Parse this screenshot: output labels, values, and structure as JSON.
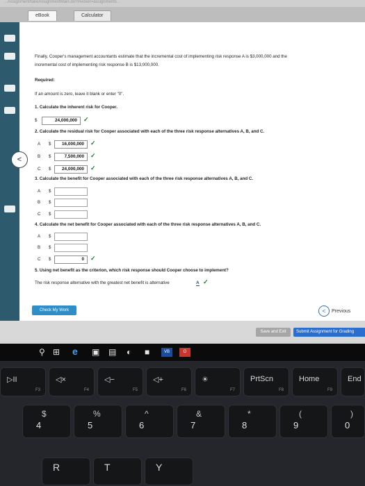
{
  "browser": {
    "url_fragment": "...Assignment/takeAssignmentMain.do?invoker=assignments...",
    "tabs": [
      "eBook",
      "Calculator"
    ]
  },
  "problem": {
    "intro_line1": "Finally, Cooper's management accountants estimate that the incremental cost of implementing risk response A is $3,000,000 and the",
    "intro_line2": "incremental cost of implementing risk response B is $13,000,000.",
    "required_label": "Required:",
    "zero_instruction": "If an amount is zero, leave it blank or enter \"0\".",
    "q1": "1. Calculate the inherent risk for Cooper.",
    "q1_answer": "24,000,000",
    "q2": "2. Calculate the residual risk for Cooper associated with each of the three risk response alternatives A, B, and C.",
    "q2_answers": [
      {
        "label": "A",
        "value": "16,000,000"
      },
      {
        "label": "B",
        "value": "7,500,000"
      },
      {
        "label": "C",
        "value": "24,000,000"
      }
    ],
    "q3": "3. Calculate the benefit for Cooper associated with each of the three risk response alternatives A, B, and C.",
    "q3_answers": [
      {
        "label": "A",
        "value": ""
      },
      {
        "label": "B",
        "value": ""
      },
      {
        "label": "C",
        "value": ""
      }
    ],
    "q4": "4. Calculate the net benefit for Cooper associated with each of the three risk response alternatives A, B, and C.",
    "q4_answers": [
      {
        "label": "A",
        "value": ""
      },
      {
        "label": "B",
        "value": ""
      },
      {
        "label": "C",
        "value": "0"
      }
    ],
    "q5": "5. Using net benefit as the criterion, which risk response should Cooper choose to implement?",
    "q5_sentence": "The risk response alternative with the greatest net benefit is alternative",
    "q5_answer": "A",
    "dollar": "$"
  },
  "buttons": {
    "check_my_work": "Check My Work",
    "previous": "Previous",
    "save_exit": "Save and Exit",
    "submit": "Submit Assignment for Grading"
  },
  "keyboard": {
    "fn_row": [
      {
        "main": "▷II",
        "sub": "F3"
      },
      {
        "main": "◁×",
        "sub": "F4"
      },
      {
        "main": "◁−",
        "sub": "F5"
      },
      {
        "main": "◁+",
        "sub": "F6"
      },
      {
        "main": "☀",
        "sub": "F7"
      },
      {
        "main": "PrtScn",
        "sub": "F8"
      },
      {
        "main": "Home",
        "sub": "F9"
      },
      {
        "main": "End",
        "sub": ""
      }
    ],
    "num_row": [
      {
        "sym": "$",
        "num": "4"
      },
      {
        "sym": "%",
        "num": "5"
      },
      {
        "sym": "^",
        "num": "6"
      },
      {
        "sym": "&",
        "num": "7"
      },
      {
        "sym": "*",
        "num": "8"
      },
      {
        "sym": "(",
        "num": "9"
      },
      {
        "sym": ")",
        "num": "0"
      }
    ],
    "letter_row": [
      "R",
      "T",
      "Y"
    ]
  },
  "colors": {
    "check": "#1a7a2a",
    "link": "#1e4fa8",
    "check_button": "#2f8ec8",
    "submit_button": "#2a6fd0"
  }
}
